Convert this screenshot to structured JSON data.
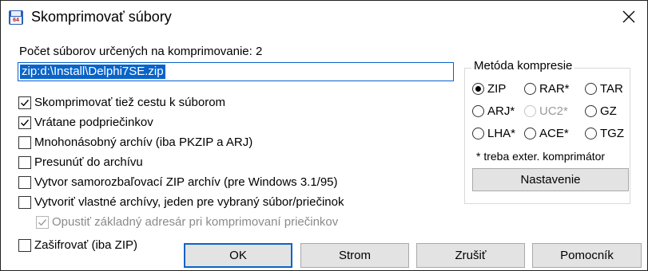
{
  "window": {
    "title": "Skomprimovať súbory"
  },
  "file_count_label": "Počet súborov určených na komprimovanie: 2",
  "path_input": {
    "value": "zip:d:\\Install\\Delphi7SE.zip"
  },
  "options": [
    {
      "label": "Skomprimovať tiež cestu k súborom",
      "checked": true
    },
    {
      "label": "Vrátane podpriečinkov",
      "checked": true
    },
    {
      "label": "Mnohonásobný archív (iba PKZIP a ARJ)",
      "checked": false
    },
    {
      "label": "Presunúť do archívu",
      "checked": false
    },
    {
      "label": "Vytvor samorozbaľovací ZIP archív (pre Windows 3.1/95)",
      "checked": false
    },
    {
      "label": "Vytvoriť vlastné archívy, jeden pre vybraný súbor/priečinok",
      "checked": false
    }
  ],
  "sub_option": {
    "label": "Opustiť základný adresár pri komprimovaní priečinkov",
    "checked": true,
    "disabled": true
  },
  "encrypt_option": {
    "label": "Zašifrovať (iba ZIP)",
    "checked": false
  },
  "compression": {
    "group_title": "Metóda kompresie",
    "methods": [
      {
        "label": "ZIP",
        "selected": true,
        "disabled": false
      },
      {
        "label": "RAR*",
        "selected": false,
        "disabled": false
      },
      {
        "label": "TAR",
        "selected": false,
        "disabled": false
      },
      {
        "label": "ARJ*",
        "selected": false,
        "disabled": false
      },
      {
        "label": "UC2*",
        "selected": false,
        "disabled": true
      },
      {
        "label": "GZ",
        "selected": false,
        "disabled": false
      },
      {
        "label": "LHA*",
        "selected": false,
        "disabled": false
      },
      {
        "label": "ACE*",
        "selected": false,
        "disabled": false
      },
      {
        "label": "TGZ",
        "selected": false,
        "disabled": false
      }
    ],
    "note": "* treba exter. komprimátor",
    "settings_button": "Nastavenie"
  },
  "buttons": {
    "ok": "OK",
    "tree": "Strom",
    "cancel": "Zrušiť",
    "help": "Pomocník"
  },
  "icons": {
    "app": "compress-icon",
    "close": "close-icon"
  },
  "colors": {
    "accent": "#0a64c8",
    "button_face": "#e3e3e3",
    "disabled_text": "#8a8a8a"
  }
}
